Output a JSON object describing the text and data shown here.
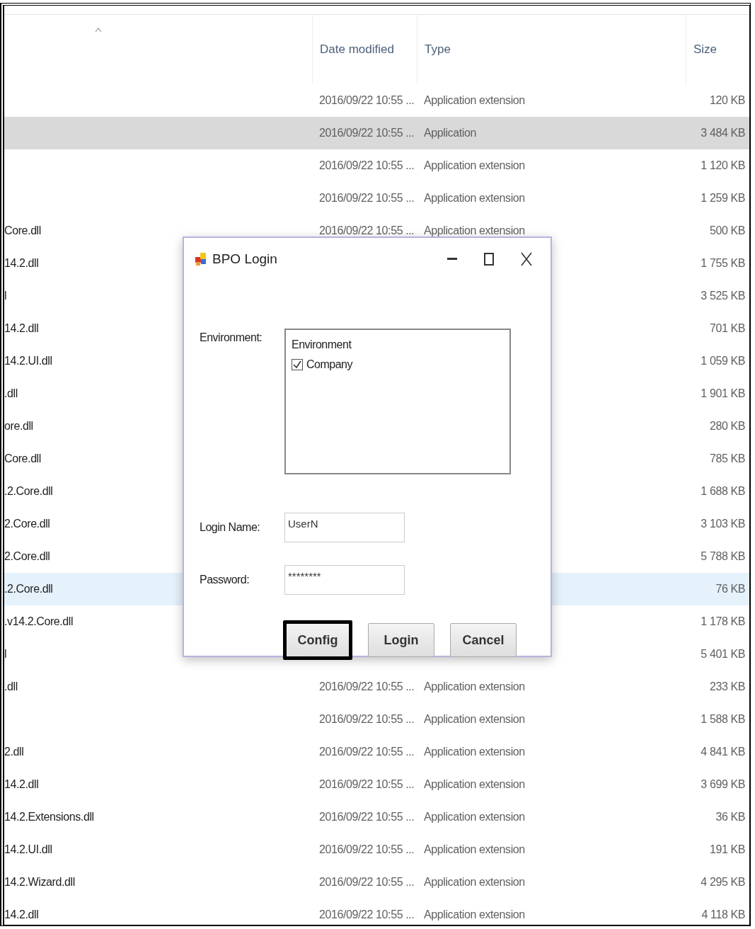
{
  "header": {
    "columns": [
      {
        "label": "Date modified"
      },
      {
        "label": "Type"
      },
      {
        "label": "Size"
      }
    ]
  },
  "files": [
    {
      "date": "2016/09/22 10:55 ...",
      "type": "Application extension",
      "size": "120 KB",
      "selected": false,
      "hovered": false
    },
    {
      "date": "2016/09/22 10:55 ...",
      "type": "Application",
      "size": "3 484 KB",
      "selected": true,
      "hovered": false
    },
    {
      "date": "2016/09/22 10:55 ...",
      "type": "Application extension",
      "size": "1 120 KB",
      "selected": false,
      "hovered": false
    },
    {
      "date": "2016/09/22 10:55 ...",
      "type": "Application extension",
      "size": "1 259 KB",
      "selected": false,
      "hovered": false
    },
    {
      "name": "Core.dll",
      "date": "2016/09/22 10:55 ...",
      "type": "Application extension",
      "size": "500 KB",
      "selected": false,
      "hovered": false
    },
    {
      "name": "14.2.dll",
      "size": "1 755 KB",
      "selected": false,
      "hovered": false
    },
    {
      "name": "l",
      "size": "3 525 KB",
      "selected": false,
      "hovered": false
    },
    {
      "name": "14.2.dll",
      "size": "701 KB",
      "selected": false,
      "hovered": false
    },
    {
      "name": "14.2.UI.dll",
      "size": "1 059 KB",
      "selected": false,
      "hovered": false
    },
    {
      "name": ".dll",
      "size": "1 901 KB",
      "selected": false,
      "hovered": false
    },
    {
      "name": "ore.dll",
      "size": "280 KB",
      "selected": false,
      "hovered": false
    },
    {
      "name": "Core.dll",
      "size": "785 KB",
      "selected": false,
      "hovered": false
    },
    {
      "name": ".2.Core.dll",
      "size": "1 688 KB",
      "selected": false,
      "hovered": false
    },
    {
      "name": "2.Core.dll",
      "size": "3 103 KB",
      "selected": false,
      "hovered": false
    },
    {
      "name": "2.Core.dll",
      "size": "5 788 KB",
      "selected": false,
      "hovered": false
    },
    {
      "name": ".2.Core.dll",
      "size": "76 KB",
      "selected": false,
      "hovered": true
    },
    {
      "name": ".v14.2.Core.dll",
      "size": "1 178 KB",
      "selected": false,
      "hovered": false
    },
    {
      "name": "l",
      "size": "5 401 KB",
      "selected": false,
      "hovered": false
    },
    {
      "name": ".dll",
      "date": "2016/09/22 10:55 ...",
      "type": "Application extension",
      "size": "233 KB",
      "selected": false,
      "hovered": false
    },
    {
      "date": "2016/09/22 10:55 ...",
      "type": "Application extension",
      "size": "1 588 KB",
      "selected": false,
      "hovered": false
    },
    {
      "name": "2.dll",
      "date": "2016/09/22 10:55 ...",
      "type": "Application extension",
      "size": "4 841 KB",
      "selected": false,
      "hovered": false
    },
    {
      "name": "14.2.dll",
      "date": "2016/09/22 10:55 ...",
      "type": "Application extension",
      "size": "3 699 KB",
      "selected": false,
      "hovered": false
    },
    {
      "name": "14.2.Extensions.dll",
      "date": "2016/09/22 10:55 ...",
      "type": "Application extension",
      "size": "36 KB",
      "selected": false,
      "hovered": false
    },
    {
      "name": "14.2.UI.dll",
      "date": "2016/09/22 10:55 ...",
      "type": "Application extension",
      "size": "191 KB",
      "selected": false,
      "hovered": false
    },
    {
      "name": "14.2.Wizard.dll",
      "date": "2016/09/22 10:55 ...",
      "type": "Application extension",
      "size": "4 295 KB",
      "selected": false,
      "hovered": false
    },
    {
      "name": "14.2.dll",
      "date": "2016/09/22 10:55 ...",
      "type": "Application extension",
      "size": "4 118 KB",
      "selected": false,
      "hovered": false
    }
  ],
  "dialog": {
    "title": "BPO Login",
    "environment": {
      "label": "Environment:",
      "list_header": "Environment",
      "items": [
        {
          "label": "Company",
          "checked": true
        }
      ]
    },
    "login_name": {
      "label": "Login Name:",
      "value": "UserN"
    },
    "password": {
      "label": "Password:",
      "value": "********"
    },
    "buttons": [
      {
        "label": "Config",
        "focused": true
      },
      {
        "label": "Login",
        "focused": false
      },
      {
        "label": "Cancel",
        "focused": false
      }
    ]
  }
}
